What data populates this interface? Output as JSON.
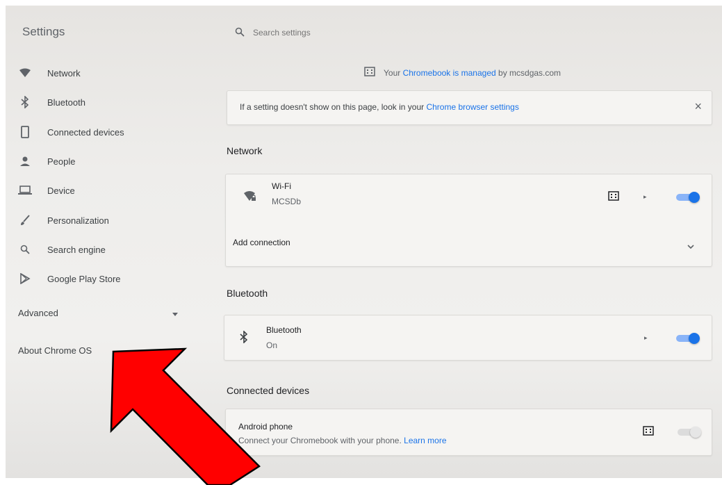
{
  "sidebar": {
    "title": "Settings",
    "items": [
      {
        "label": "Network",
        "icon": "wifi-icon"
      },
      {
        "label": "Bluetooth",
        "icon": "bluetooth-icon"
      },
      {
        "label": "Connected devices",
        "icon": "phone-icon"
      },
      {
        "label": "People",
        "icon": "person-icon"
      },
      {
        "label": "Device",
        "icon": "laptop-icon"
      },
      {
        "label": "Personalization",
        "icon": "brush-icon"
      },
      {
        "label": "Search engine",
        "icon": "search-icon"
      },
      {
        "label": "Google Play Store",
        "icon": "play-store-icon"
      }
    ],
    "advanced": "Advanced",
    "about": "About Chrome OS"
  },
  "search": {
    "placeholder": "Search settings"
  },
  "managed": {
    "prefix": "Your",
    "link": "Chromebook is managed",
    "suffix": "by mcsdgas.com"
  },
  "info": {
    "text": "If a setting doesn't show on this page, look in your",
    "link": "Chrome browser settings",
    "close": "×"
  },
  "network": {
    "title": "Network",
    "wifi_label": "Wi-Fi",
    "wifi_network": "MCSDb",
    "wifi_enabled": true,
    "add_connection": "Add connection"
  },
  "bluetooth": {
    "title": "Bluetooth",
    "label": "Bluetooth",
    "status": "On",
    "enabled": true
  },
  "connected": {
    "title": "Connected devices",
    "label": "Android phone",
    "desc": "Connect your Chromebook with your phone.",
    "link": "Learn more",
    "enabled": false
  },
  "colors": {
    "accent": "#1a73e8",
    "annotation": "#ff0000"
  }
}
